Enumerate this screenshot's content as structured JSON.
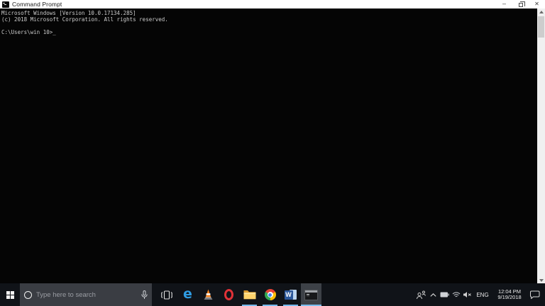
{
  "window": {
    "title": "Command Prompt",
    "controls": {
      "minimize": "–",
      "close": "✕"
    }
  },
  "console": {
    "lines": [
      "Microsoft Windows [Version 10.0.17134.285]",
      "(c) 2018 Microsoft Corporation. All rights reserved.",
      "",
      "C:\\Users\\win 10>"
    ],
    "cursor": "_"
  },
  "taskbar": {
    "search": {
      "placeholder": "Type here to search"
    },
    "apps": [
      {
        "name": "task-view",
        "running": false
      },
      {
        "name": "microsoft-edge",
        "running": false
      },
      {
        "name": "vlc-media-player",
        "running": false
      },
      {
        "name": "opera",
        "running": false
      },
      {
        "name": "file-explorer",
        "running": true
      },
      {
        "name": "google-chrome",
        "running": true
      },
      {
        "name": "microsoft-word",
        "running": true
      },
      {
        "name": "command-prompt",
        "running": true,
        "active": true
      }
    ],
    "tray": {
      "language": "ENG",
      "clock": {
        "time": "12:04 PM",
        "date": "9/19/2018"
      }
    }
  },
  "icons": {
    "start": "windows-logo",
    "cortana": "circle-ring",
    "microphone": "mic-outline",
    "people": "two-person-silhouette",
    "hidden-icons": "chevron-up",
    "battery": "battery-full",
    "network": "wifi-signal",
    "volume": "speaker-muted",
    "action-center": "speech-bubble",
    "scroll-up": "triangle-up",
    "scroll-down": "triangle-down"
  },
  "colors": {
    "accent_underline": "#76b9ed",
    "taskbar_bg": "#101318",
    "console_bg": "#050505",
    "console_text": "#cccccc",
    "titlebar_bg": "#ffffff",
    "search_box_bg": "#3a3d43"
  }
}
